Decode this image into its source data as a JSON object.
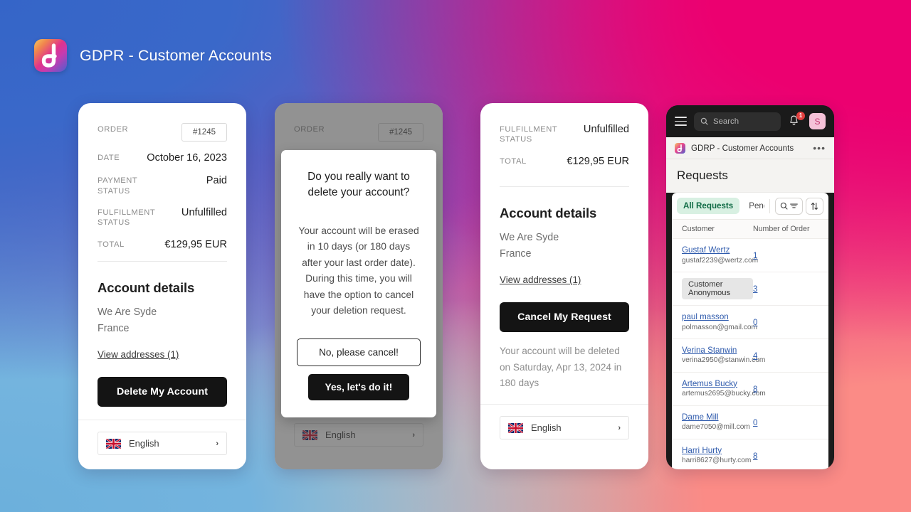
{
  "header": {
    "title": "GDPR - Customer Accounts",
    "logo_icon": "gdpr-app-logo"
  },
  "colors": {
    "bg_top_left": "#3565c8",
    "bg_top_right": "#e8006e",
    "bg_bottom_left": "#6cb0dc",
    "bg_bottom_right": "#fb8b86",
    "bg_bottom_center": "#f6edc0",
    "dark_button": "#141414",
    "accent_green": "#0f6b45",
    "link_blue": "#2e5aac",
    "badge_red": "#e03e3e",
    "avatar_pink": "#f5c2d8"
  },
  "order": {
    "rows": [
      {
        "label": "ORDER",
        "value": "#1245",
        "is_chip": true
      },
      {
        "label": "DATE",
        "value": "October 16, 2023",
        "is_chip": false
      },
      {
        "label": "PAYMENT STATUS",
        "value": "Paid",
        "is_chip": false
      },
      {
        "label": "FULFILLMENT STATUS",
        "value": "Unfulfilled",
        "is_chip": false
      },
      {
        "label": "TOTAL",
        "value": "€129,95 EUR",
        "is_chip": false
      }
    ]
  },
  "card1": {
    "account_title": "Account details",
    "company": "We Are Syde",
    "country": "France",
    "view_addresses": "View addresses (1)",
    "delete_button": "Delete My Account",
    "language": "English"
  },
  "card2": {
    "modal": {
      "title": "Do you really want to delete your account?",
      "body": "Your account will be erased in 10 days (or 180 days after your last order date). During this time, you will have the option to cancel your deletion request.",
      "cancel_button": "No, please cancel!",
      "confirm_button": "Yes, let's do it!"
    },
    "language": "English",
    "bg_order_label": "ORDER",
    "bg_order_value": "#1245"
  },
  "card3": {
    "rows": [
      {
        "label": "FULFILLMENT STATUS",
        "value": "Unfulfilled"
      },
      {
        "label": "TOTAL",
        "value": "€129,95 EUR"
      }
    ],
    "account_title": "Account details",
    "company": "We Are Syde",
    "country": "France",
    "view_addresses": "View addresses (1)",
    "cancel_request_button": "Cancel My Request",
    "deletion_note": "Your account will be deleted on Saturday, Apr 13, 2024 in 180 days",
    "language": "English"
  },
  "admin": {
    "search_placeholder": "Search",
    "notification_count": "1",
    "avatar_initial": "S",
    "app_title": "GDRP - Customer Accounts",
    "more_menu": "•••",
    "page_title": "Requests",
    "tabs": [
      {
        "label": "All Requests",
        "active": true
      },
      {
        "label": "Pending",
        "active": false
      }
    ],
    "table": {
      "headers": [
        "Customer",
        "Number of Order"
      ],
      "rows": [
        {
          "name": "Gustaf Wertz",
          "email": "gustaf2239@wertz.com",
          "orders": "1",
          "anonymous": false
        },
        {
          "name": "Customer Anonymous",
          "email": "",
          "orders": "3",
          "anonymous": true
        },
        {
          "name": "paul masson",
          "email": "polmasson@gmail.com",
          "orders": "0",
          "anonymous": false
        },
        {
          "name": "Verina Stanwin",
          "email": "verina2950@stanwin.com",
          "orders": "4",
          "anonymous": false
        },
        {
          "name": "Artemus Bucky",
          "email": "artemus2695@bucky.com",
          "orders": "8",
          "anonymous": false
        },
        {
          "name": "Dame Mill",
          "email": "dame7050@mill.com",
          "orders": "0",
          "anonymous": false
        },
        {
          "name": "Harri Hurty",
          "email": "harri8627@hurty.com",
          "orders": "8",
          "anonymous": false
        }
      ]
    }
  }
}
